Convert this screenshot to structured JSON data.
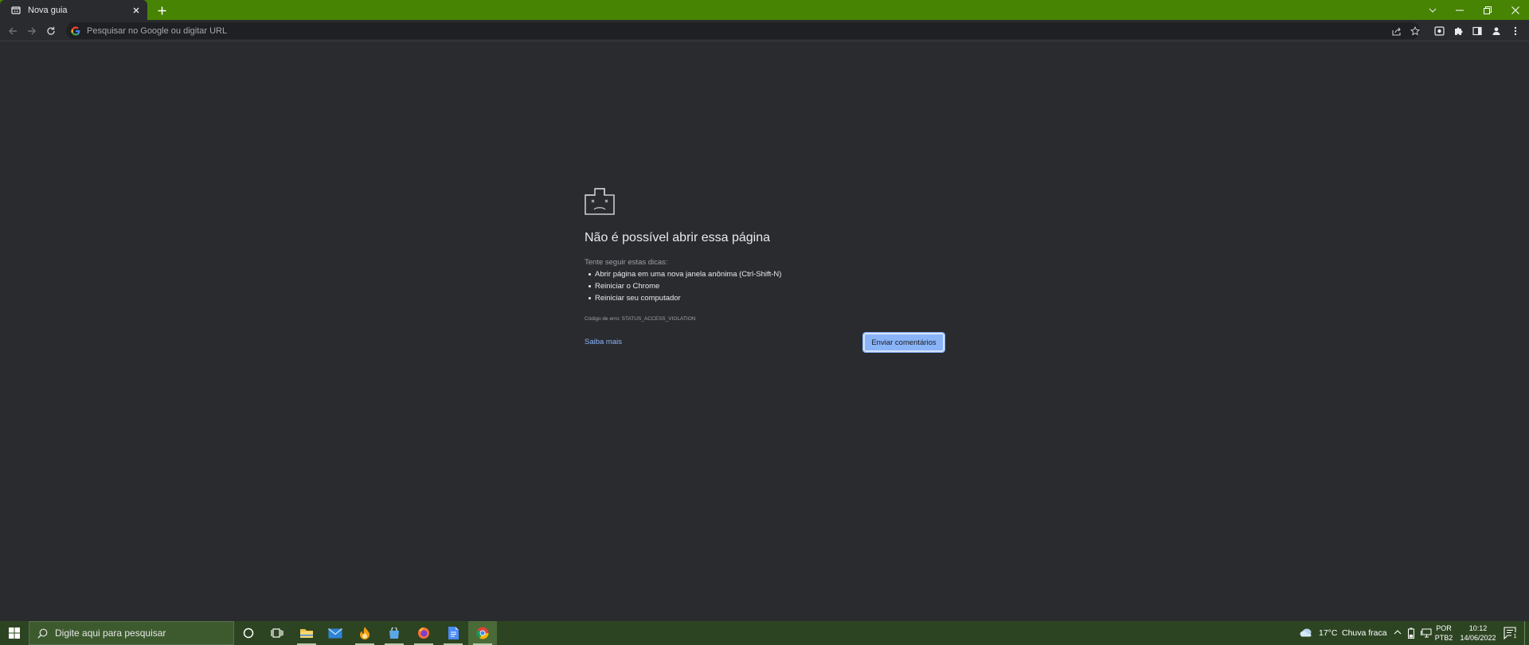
{
  "browser": {
    "tab_title": "Nova guia",
    "omnibox_placeholder": "Pesquisar no Google ou digitar URL",
    "colors": {
      "frame": "#478404",
      "toolbar": "#2a2b2f",
      "page_bg": "#2a2b2f"
    }
  },
  "error_page": {
    "title": "Não é possível abrir essa página",
    "tips_label": "Tente seguir estas dicas:",
    "tips": [
      "Abrir página em uma nova janela anônima (Ctrl-Shift-N)",
      "Reiniciar o Chrome",
      "Reiniciar seu computador"
    ],
    "error_code": "Código de erro: STATUS_ACCESS_VIOLATION",
    "learn_more_label": "Saiba mais",
    "feedback_label": "Enviar comentários",
    "colors": {
      "link": "#8ab4f8",
      "button": "#8ab4f8"
    }
  },
  "taskbar": {
    "search_placeholder": "Digite aqui para pesquisar",
    "apps": [
      "cortana-icon",
      "task-view-icon",
      "file-explorer-icon",
      "mail-icon",
      "flame-app-icon",
      "store-icon",
      "firefox-icon",
      "docs-icon",
      "chrome-icon"
    ],
    "weather_temp": "17°C",
    "weather_desc": "Chuva fraca",
    "lang_top": "POR",
    "lang_bottom": "PTB2",
    "time": "10:12",
    "date": "14/06/2022",
    "notification_count": "1",
    "colors": {
      "bar": "#2d4422"
    }
  }
}
